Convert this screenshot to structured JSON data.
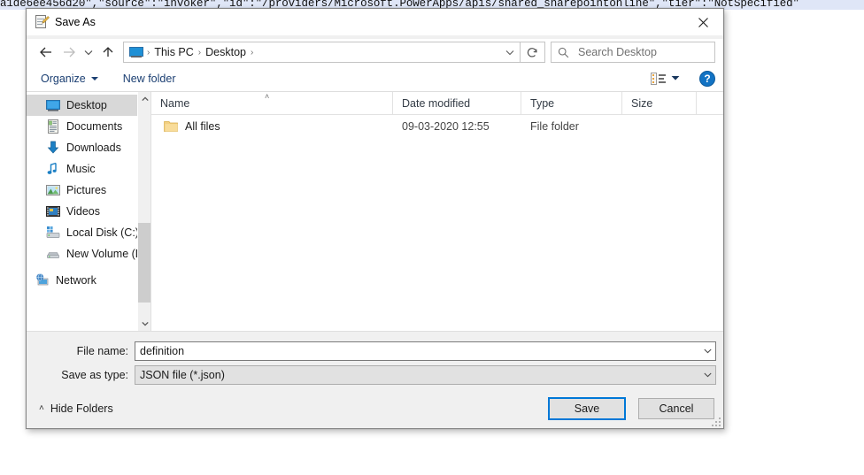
{
  "background": {
    "text": "a1de6ee456d20\",\"source\":\"invoker\",\"id\":\"/providers/Microsoft.PowerApps/apis/shared_sharepointonline\",\"tier\":\"NotSpecified\""
  },
  "dialog": {
    "title": "Save As",
    "title_icon": "notepad-edit-icon",
    "close_label": "✕"
  },
  "navbar": {
    "back_icon": "arrow-left-icon",
    "forward_icon": "arrow-right-icon",
    "recent_icon": "chevron-down-icon",
    "up_icon": "arrow-up-icon",
    "location_icon": "this-pc-icon",
    "breadcrumbs": [
      "This PC",
      "Desktop"
    ],
    "separator": "›",
    "address_caret": "chevron-down-icon",
    "refresh_icon": "refresh-icon",
    "search_icon": "search-icon",
    "search_placeholder": "Search Desktop"
  },
  "commandbar": {
    "organize_label": "Organize",
    "new_folder_label": "New folder",
    "view_icon": "list-view-icon",
    "view_caret": "chevron-down-icon",
    "help_label": "?"
  },
  "sidebar": {
    "items": [
      {
        "label": "Desktop",
        "icon": "desktop-icon",
        "selected": true,
        "type": "quick"
      },
      {
        "label": "Documents",
        "icon": "documents-icon",
        "selected": false,
        "type": "quick"
      },
      {
        "label": "Downloads",
        "icon": "downloads-icon",
        "selected": false,
        "type": "quick"
      },
      {
        "label": "Music",
        "icon": "music-icon",
        "selected": false,
        "type": "quick"
      },
      {
        "label": "Pictures",
        "icon": "pictures-icon",
        "selected": false,
        "type": "quick"
      },
      {
        "label": "Videos",
        "icon": "videos-icon",
        "selected": false,
        "type": "quick"
      },
      {
        "label": "Local Disk (C:)",
        "icon": "local-disk-icon",
        "selected": false,
        "type": "quick"
      },
      {
        "label": "New Volume (D:",
        "icon": "drive-icon",
        "selected": false,
        "type": "quick"
      },
      {
        "label": "Network",
        "icon": "network-icon",
        "selected": false,
        "type": "root"
      }
    ],
    "scroll_up_icon": "chevron-up-icon",
    "scroll_down_icon": "chevron-down-icon"
  },
  "filelist": {
    "columns": [
      {
        "label": "Name",
        "sorted": true,
        "sort_icon": "˄"
      },
      {
        "label": "Date modified",
        "sorted": false
      },
      {
        "label": "Type",
        "sorted": false
      },
      {
        "label": "Size",
        "sorted": false
      }
    ],
    "rows": [
      {
        "name": "All files",
        "icon": "folder-icon",
        "date_modified": "09-03-2020 12:55",
        "type": "File folder",
        "size": ""
      }
    ]
  },
  "form": {
    "file_name_label": "File name:",
    "file_name_value": "definition",
    "file_name_caret": "chevron-down-icon",
    "save_as_type_label": "Save as type:",
    "save_as_type_value": "JSON file (*.json)",
    "save_as_type_caret": "chevron-down-icon"
  },
  "footer": {
    "hide_folders_label": "Hide Folders",
    "hide_folders_caret": "˄",
    "save_label": "Save",
    "cancel_label": "Cancel"
  },
  "colors": {
    "accent": "#0078d7",
    "dialog_bg": "#f0f0f0",
    "selection": "#d8d8d8",
    "folder": "#f5d07f",
    "link_text": "#1b3f72"
  }
}
